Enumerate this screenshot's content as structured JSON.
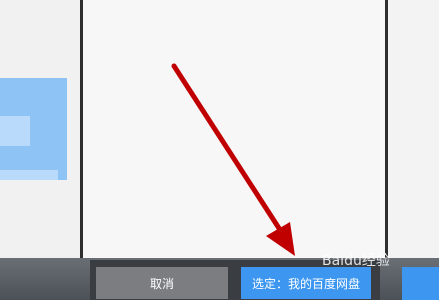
{
  "dialog": {
    "cancel_label": "取消",
    "select_label": "选定：我的百度网盘"
  },
  "watermark": {
    "text": "Baidu经验"
  },
  "colors": {
    "accent": "#3d97f0",
    "arrow": "#c00000"
  }
}
